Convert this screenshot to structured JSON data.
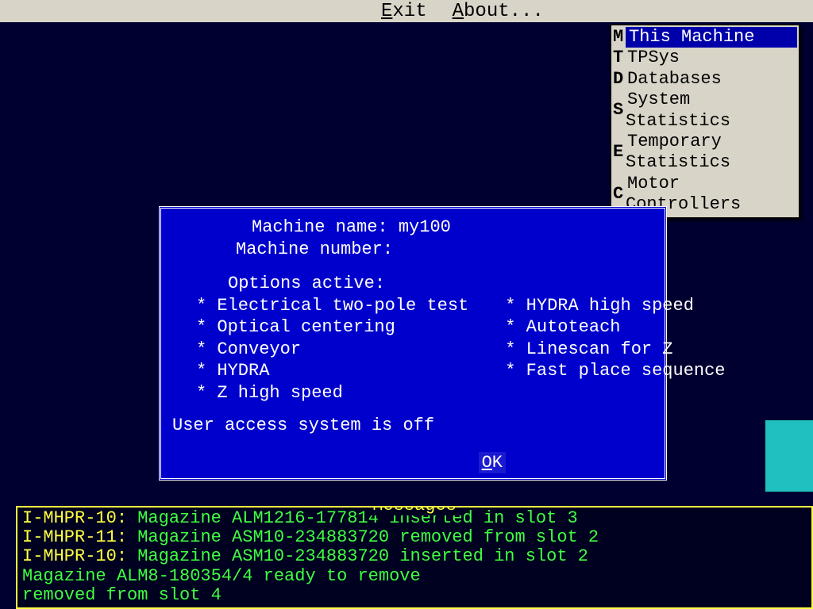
{
  "menubar": {
    "items": [
      {
        "label": "Exit"
      },
      {
        "label": "About..."
      }
    ]
  },
  "dropdown": {
    "items": [
      {
        "hotkey": "M",
        "label": "This Machine",
        "selected": true
      },
      {
        "hotkey": "T",
        "label": "TPSys",
        "selected": false
      },
      {
        "hotkey": "D",
        "label": "Databases",
        "selected": false
      },
      {
        "hotkey": "S",
        "label": "System Statistics",
        "selected": false
      },
      {
        "hotkey": "E",
        "label": "Temporary Statistics",
        "selected": false
      },
      {
        "hotkey": "C",
        "label": "Motor Controllers",
        "selected": false
      }
    ]
  },
  "dialog": {
    "machine_name_label": "Machine name:",
    "machine_name_value": "my100",
    "machine_number_label": "Machine number:",
    "machine_number_value": "",
    "options_header": "Options active:",
    "options_col1": [
      "* Electrical two-pole test",
      "* Optical centering",
      "* Conveyor",
      "* HYDRA",
      "* Z high speed"
    ],
    "options_col2": [
      "* HYDRA high speed",
      "* Autoteach",
      "* Linescan for Z",
      "* Fast place sequence"
    ],
    "access_line": "User access system is off",
    "ok_label": "OK"
  },
  "messages": {
    "title": "Messages",
    "lines": [
      {
        "code": "I-MHPR-10:",
        "text": "Magazine ALM1216-177814 inserted in slot 3"
      },
      {
        "code": "I-MHPR-11:",
        "text": "Magazine ASM10-234883720 removed from slot 2"
      },
      {
        "code": "I-MHPR-10:",
        "text": "Magazine ASM10-234883720 inserted in slot 2"
      },
      {
        "code": "",
        "text": "Magazine ALM8-180354/4 ready to remove"
      },
      {
        "code": "",
        "text": "                               removed from slot 4"
      }
    ]
  }
}
